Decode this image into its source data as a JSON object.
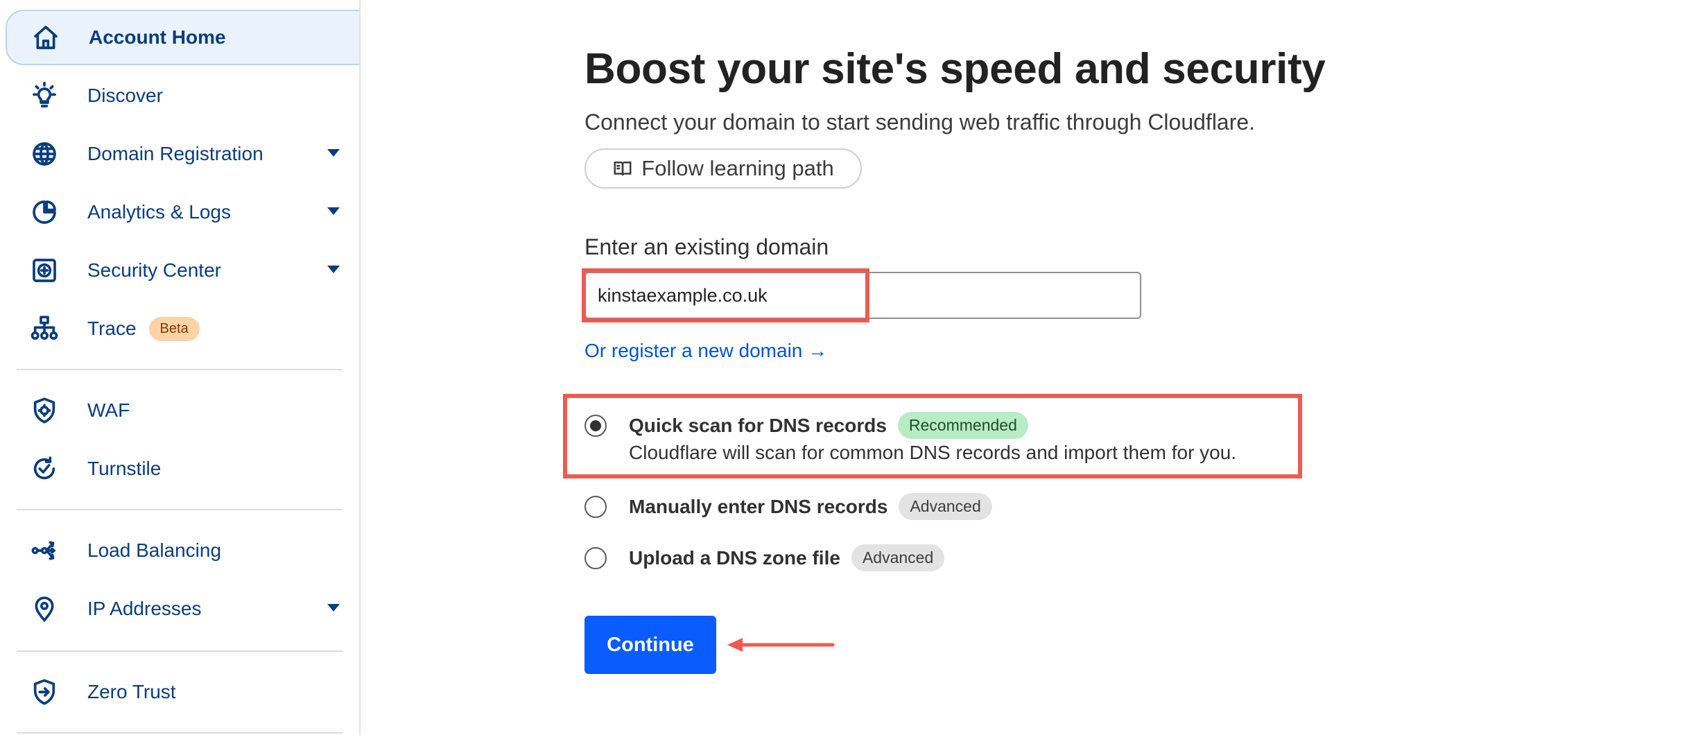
{
  "sidebar": {
    "items": [
      {
        "label": "Account Home",
        "icon": "home-icon"
      },
      {
        "label": "Discover",
        "icon": "lightbulb-icon"
      },
      {
        "label": "Domain Registration",
        "icon": "globe-icon"
      },
      {
        "label": "Analytics & Logs",
        "icon": "pie-chart-icon"
      },
      {
        "label": "Security Center",
        "icon": "security-center-icon"
      },
      {
        "label": "Trace",
        "icon": "trace-icon",
        "badge": "Beta"
      },
      {
        "label": "WAF",
        "icon": "shield-gear-icon"
      },
      {
        "label": "Turnstile",
        "icon": "turnstile-icon"
      },
      {
        "label": "Load Balancing",
        "icon": "load-balancing-icon"
      },
      {
        "label": "IP Addresses",
        "icon": "location-pin-icon"
      },
      {
        "label": "Zero Trust",
        "icon": "zero-trust-icon"
      }
    ]
  },
  "main": {
    "title": "Boost your site's speed and security",
    "subtitle": "Connect your domain to start sending web traffic through Cloudflare.",
    "learning_button": "Follow learning path",
    "domain_label": "Enter an existing domain",
    "domain_value": "kinstaexample.co.uk",
    "register_link": "Or register a new domain →",
    "options": [
      {
        "label": "Quick scan for DNS records",
        "badge": "Recommended",
        "description": "Cloudflare will scan for common DNS records and import them for you.",
        "selected": true
      },
      {
        "label": "Manually enter DNS records",
        "badge": "Advanced",
        "selected": false
      },
      {
        "label": "Upload a DNS zone file",
        "badge": "Advanced",
        "selected": false
      }
    ],
    "continue_label": "Continue"
  },
  "colors": {
    "accent": "#0a5cff",
    "nav_text": "#0a3d7d",
    "highlight": "#ee5a52",
    "link": "#0055cc"
  }
}
